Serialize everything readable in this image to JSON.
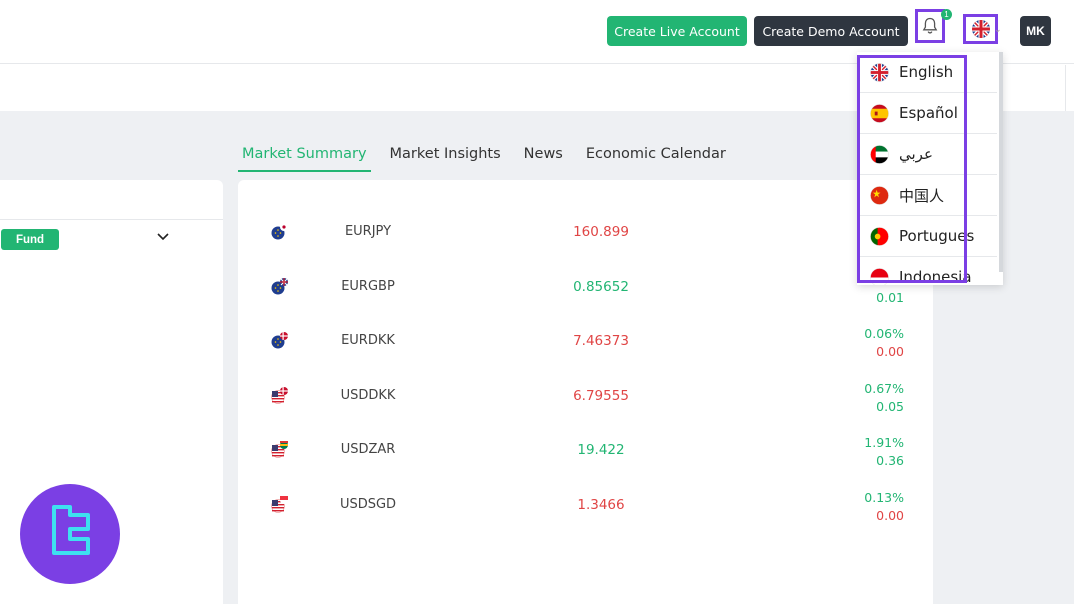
{
  "header": {
    "create_live_label": "Create Live Account",
    "create_demo_label": "Create Demo Account",
    "notification_count": "1",
    "avatar_initials": "MK"
  },
  "tabs": [
    {
      "label": "Market Summary",
      "active": true
    },
    {
      "label": "Market Insights",
      "active": false
    },
    {
      "label": "News",
      "active": false
    },
    {
      "label": "Economic Calendar",
      "active": false
    }
  ],
  "left_panel": {
    "fund_label": "Fund"
  },
  "market_rows": [
    {
      "symbol": "EURJPY",
      "price": "160.899",
      "price_color": "red",
      "pct": "",
      "change": "",
      "change_color": "red",
      "icon": "eur-jpy-flag-icon"
    },
    {
      "symbol": "EURGBP",
      "price": "0.85652",
      "price_color": "green",
      "pct": "",
      "change": "0.01",
      "change_color": "green",
      "icon": "eur-gbp-flag-icon"
    },
    {
      "symbol": "EURDKK",
      "price": "7.46373",
      "price_color": "red",
      "pct": "0.06%",
      "change": "0.00",
      "change_color": "red",
      "icon": "eur-dkk-flag-icon"
    },
    {
      "symbol": "USDDKK",
      "price": "6.79555",
      "price_color": "red",
      "pct": "0.67%",
      "change": "0.05",
      "change_color": "green",
      "icon": "usd-dkk-flag-icon"
    },
    {
      "symbol": "USDZAR",
      "price": "19.422",
      "price_color": "green",
      "pct": "1.91%",
      "change": "0.36",
      "change_color": "green",
      "icon": "usd-zar-flag-icon"
    },
    {
      "symbol": "USDSGD",
      "price": "1.3466",
      "price_color": "red",
      "pct": "0.13%",
      "change": "0.00",
      "change_color": "red",
      "icon": "usd-sgd-flag-icon"
    }
  ],
  "language_menu": [
    {
      "label": "English",
      "icon": "uk-flag-icon"
    },
    {
      "label": "Español",
      "icon": "spain-flag-icon"
    },
    {
      "label": "عربي",
      "icon": "uae-flag-icon"
    },
    {
      "label": "中国人",
      "icon": "china-flag-icon"
    },
    {
      "label": "Portugues",
      "icon": "portugal-flag-icon"
    },
    {
      "label": "Indonesia",
      "icon": "indonesia-flag-icon"
    }
  ],
  "colors": {
    "accent_green": "#22b573",
    "dark_button": "#2f3640",
    "highlight_purple": "#7b3fe4",
    "negative_red": "#e04545"
  }
}
